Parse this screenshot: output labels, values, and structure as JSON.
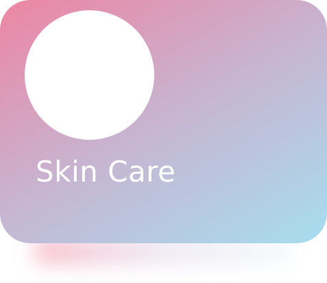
{
  "card": {
    "title": "Skin Care",
    "icon": "blank-circle-icon",
    "gradient_start": "#ec85a3",
    "gradient_mid": "#c7b5d1",
    "gradient_end": "#a6ddef",
    "text_color": "#ffffff"
  }
}
